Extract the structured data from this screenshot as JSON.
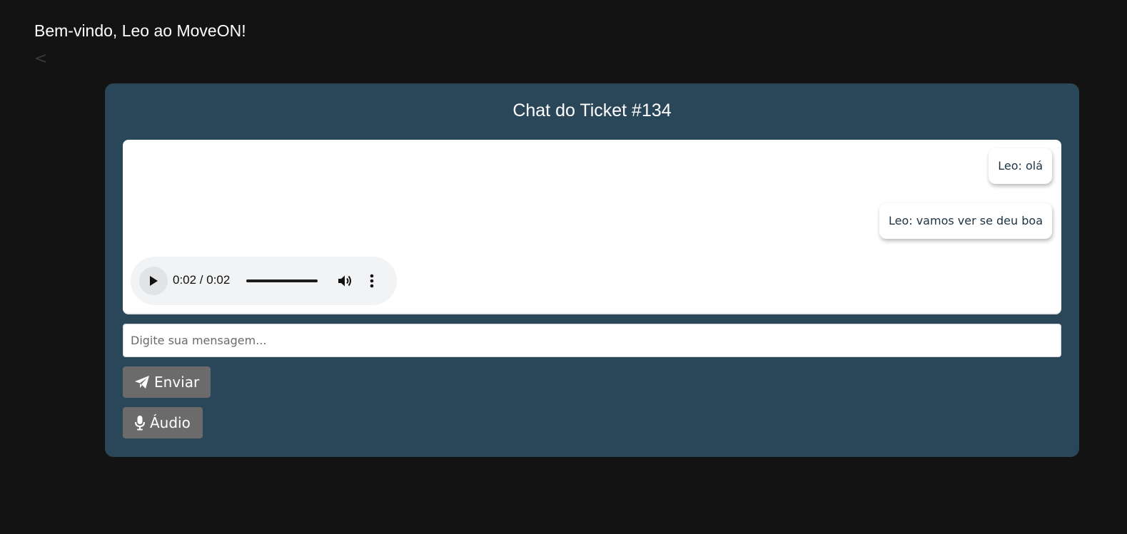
{
  "header": {
    "welcome_text": "Bem-vindo, Leo ao MoveON!",
    "back_label": "<"
  },
  "chat": {
    "title": "Chat do Ticket #134",
    "messages": [
      {
        "text": "Leo: olá"
      },
      {
        "text": "Leo: vamos ver se deu boa"
      }
    ],
    "audio": {
      "time_display": "0:02 / 0:02",
      "progress": 1.0,
      "play_icon": "play-icon",
      "volume_icon": "volume-icon",
      "more_icon": "more-vert-icon"
    }
  },
  "composer": {
    "placeholder": "Digite sua mensagem...",
    "value": "",
    "send_label": "Enviar",
    "send_icon": "paper-plane-icon",
    "audio_label": "Áudio",
    "audio_icon": "microphone-icon"
  },
  "colors": {
    "page_background": "#131313",
    "card_background": "#2a4759",
    "button_background": "#6b6b6b",
    "bubble_text": "#1c3344"
  }
}
